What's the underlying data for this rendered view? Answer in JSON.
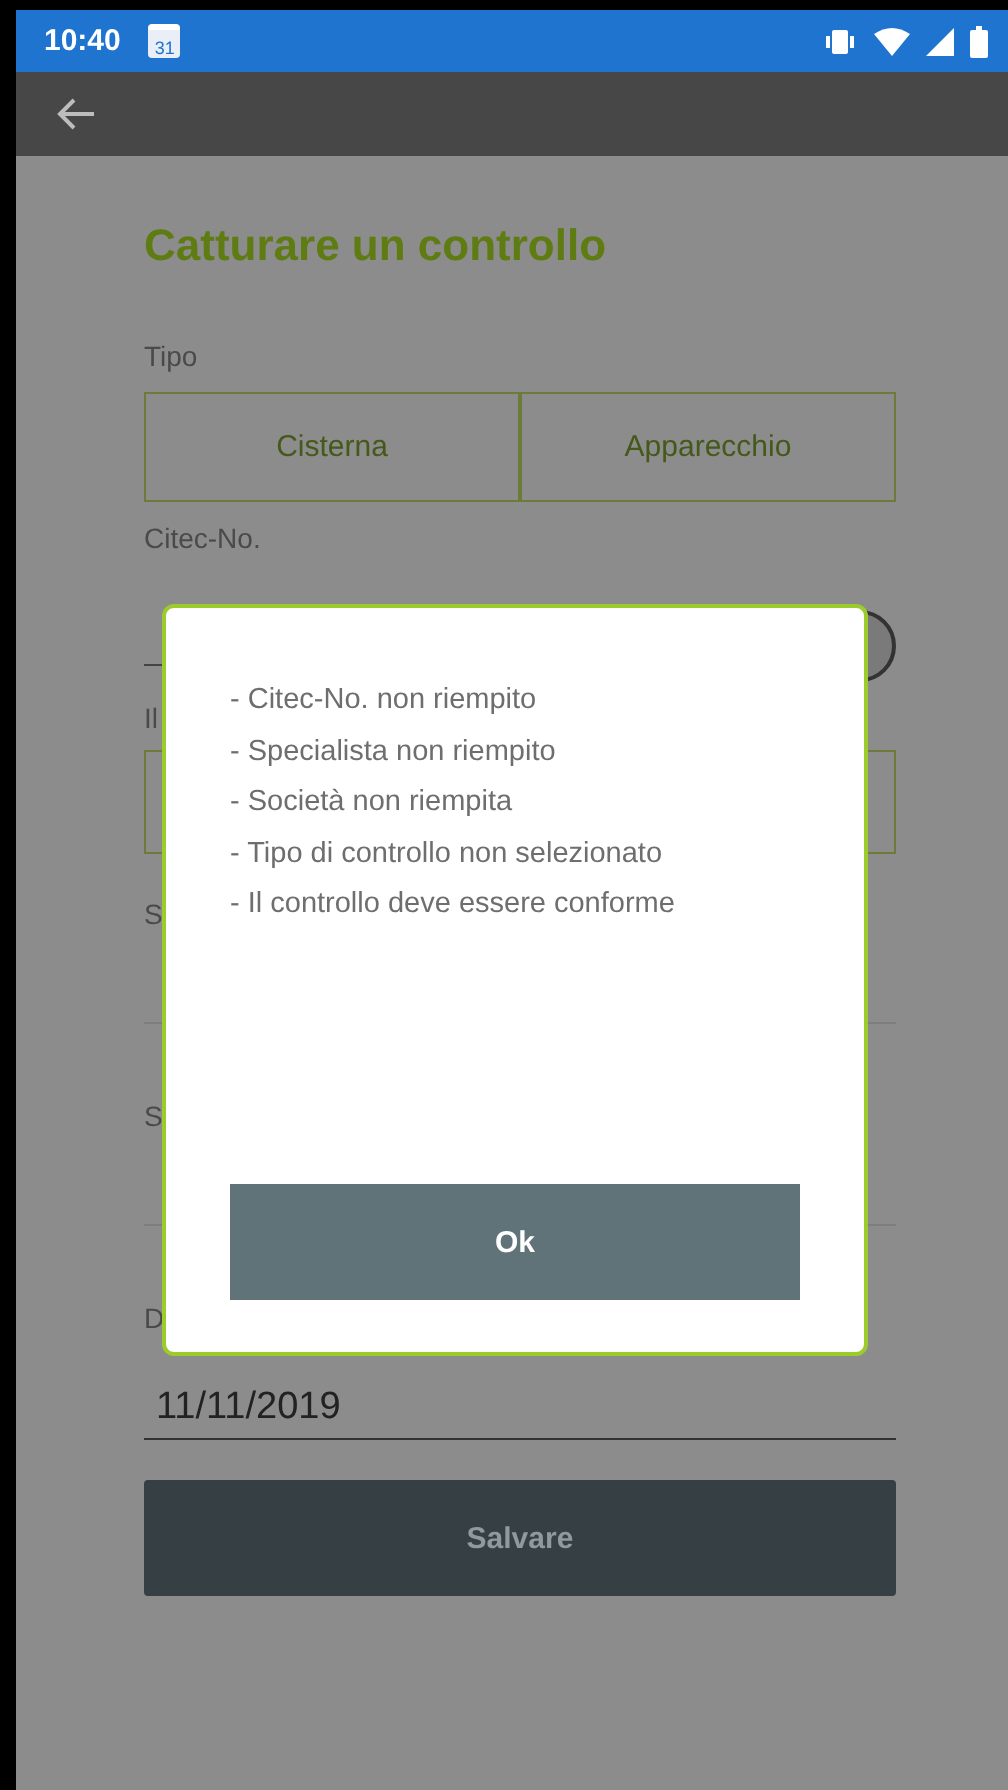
{
  "status_bar": {
    "time": "10:40",
    "calendar_day": "31"
  },
  "page": {
    "title": "Catturare un controllo",
    "type_label": "Tipo",
    "type_options": [
      {
        "label": "Cisterna",
        "selected": false
      },
      {
        "label": "Apparecchio",
        "selected": false
      }
    ],
    "citec_label": "Citec-No.",
    "label_4": "Il",
    "label_5": "S",
    "label_6": "S",
    "label_7": "D",
    "date_value": "11/11/2019",
    "save_button": "Salvare"
  },
  "dialog": {
    "messages": [
      "- Citec-No. non riempito",
      "- Specialista non riempito",
      "- Società non riempita",
      "- Tipo di controllo non selezionato",
      "- Il controllo deve essere conforme"
    ],
    "ok_button": "Ok"
  }
}
